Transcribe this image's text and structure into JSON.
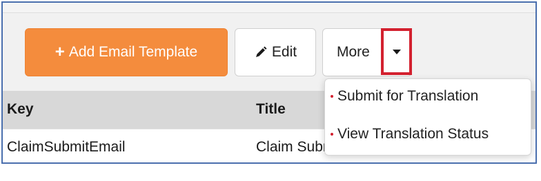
{
  "toolbar": {
    "add_label": "Add Email Template",
    "edit_label": "Edit",
    "more_label": "More"
  },
  "table": {
    "columns": [
      "Key",
      "Title"
    ],
    "rows": [
      {
        "key": "ClaimSubmitEmail",
        "title": "Claim Submit"
      }
    ]
  },
  "dropdown": {
    "items": [
      "Submit for Translation",
      "View Translation Status"
    ]
  },
  "colors": {
    "primary": "#f48c3d",
    "highlight": "#d3212f",
    "frame_border": "#4a6fae"
  },
  "icons": [
    "plus-icon",
    "pencil-icon",
    "caret-down-icon"
  ]
}
